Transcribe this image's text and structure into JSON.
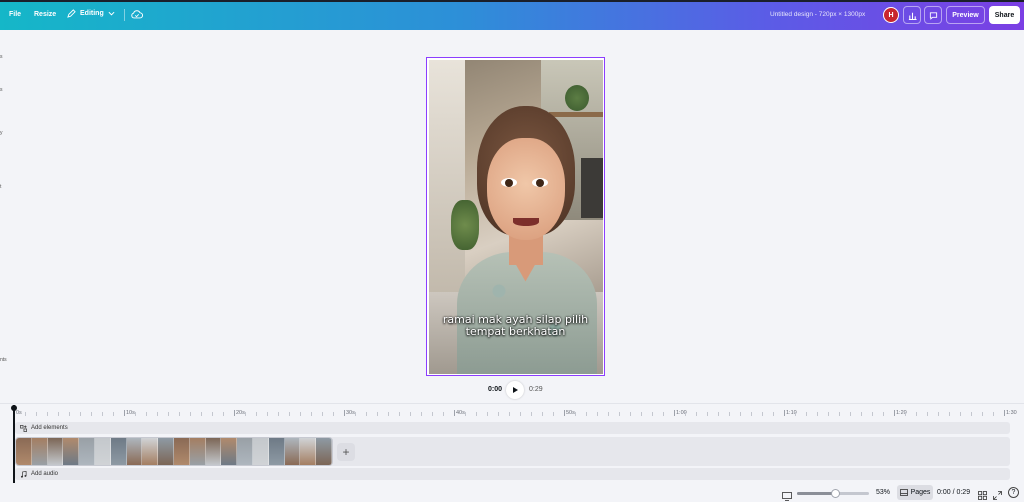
{
  "topbar": {
    "file_label": "File",
    "resize_label": "Resize",
    "editing_label": "Editing",
    "design_title": "Untitled design - 720px × 1300px",
    "avatar_initial": "H",
    "preview_label": "Preview",
    "share_label": "Share"
  },
  "sidebar_fragments": [
    "s",
    "s",
    "y",
    "t",
    "nts"
  ],
  "canvas": {
    "caption_line1": "ramai mak ayah silap pilih",
    "caption_line2": "tempat berkhatan"
  },
  "playback": {
    "current_time": "0:00",
    "duration": "0:29"
  },
  "timeline": {
    "ruler_labels": [
      "0s",
      "10s",
      "20s",
      "30s",
      "40s",
      "50s",
      "1:00",
      "1:10",
      "1:20",
      "1:30"
    ],
    "add_elements_label": "Add elements",
    "add_audio_label": "Add audio",
    "clip_count": 20
  },
  "bottombar": {
    "zoom_level_percent": 53,
    "zoom_label": "53%",
    "pages_label": "Pages",
    "time_display": "0:00 / 0:29"
  },
  "colors": {
    "gradient_start": "#15b7c8",
    "gradient_end": "#7b3fe4",
    "selection_border": "#8b3dff",
    "avatar": "#c8262e"
  }
}
